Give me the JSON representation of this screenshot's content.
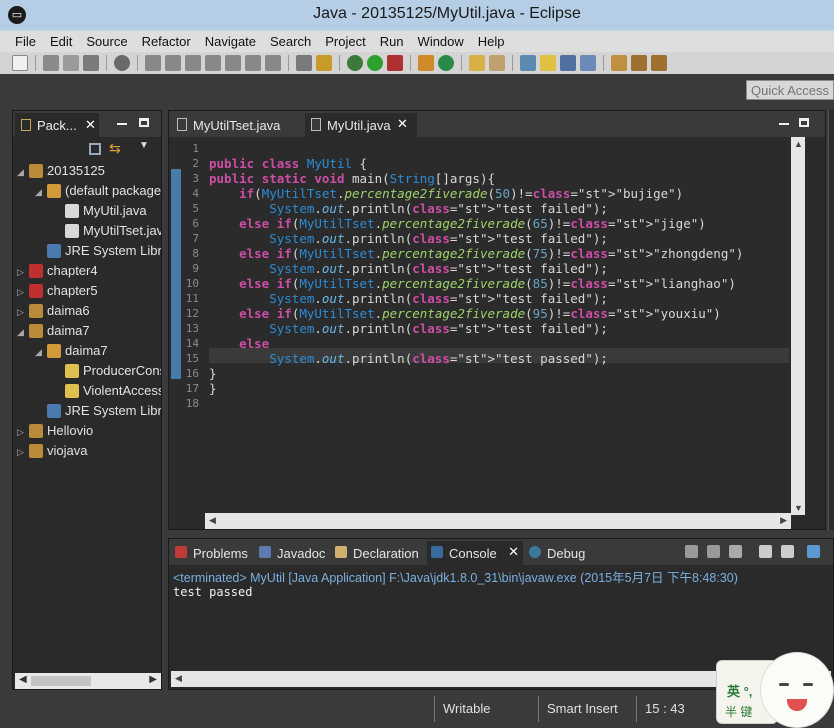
{
  "window": {
    "title": "Java - 20135125/MyUtil.java - Eclipse"
  },
  "menu": [
    "File",
    "Edit",
    "Source",
    "Refactor",
    "Navigate",
    "Search",
    "Project",
    "Run",
    "Window",
    "Help"
  ],
  "quick_access": {
    "placeholder": "Quick Access"
  },
  "package_explorer": {
    "tab_label": "Pack...",
    "tree": [
      {
        "label": "20135125",
        "depth": 0,
        "icon": "project-icon",
        "expanded": true
      },
      {
        "label": "(default package)",
        "depth": 1,
        "icon": "package-icon",
        "expanded": true
      },
      {
        "label": "MyUtil.java",
        "depth": 2,
        "icon": "java-file-icon"
      },
      {
        "label": "MyUtilTset.java",
        "depth": 2,
        "icon": "java-file-icon"
      },
      {
        "label": "JRE System Library",
        "depth": 1,
        "icon": "library-icon"
      },
      {
        "label": "chapter4",
        "depth": 0,
        "icon": "project-error-icon"
      },
      {
        "label": "chapter5",
        "depth": 0,
        "icon": "project-error-icon"
      },
      {
        "label": "daima6",
        "depth": 0,
        "icon": "project-icon"
      },
      {
        "label": "daima7",
        "depth": 0,
        "icon": "project-icon",
        "expanded": true
      },
      {
        "label": "daima7",
        "depth": 1,
        "icon": "package-icon",
        "expanded": true
      },
      {
        "label": "ProducerConsumer.java",
        "depth": 2,
        "icon": "java-warn-icon"
      },
      {
        "label": "ViolentAccess.java",
        "depth": 2,
        "icon": "java-warn-icon"
      },
      {
        "label": "JRE System Library",
        "depth": 1,
        "icon": "library-icon"
      },
      {
        "label": "Hellovio",
        "depth": 0,
        "icon": "project-icon"
      },
      {
        "label": "viojava",
        "depth": 0,
        "icon": "project-icon"
      }
    ]
  },
  "editor": {
    "tabs": [
      {
        "label": "MyUtilTset.java",
        "active": false
      },
      {
        "label": "MyUtil.java",
        "active": true
      }
    ],
    "line_numbers": [
      "1",
      "2",
      "3",
      "4",
      "5",
      "6",
      "7",
      "8",
      "9",
      "10",
      "11",
      "12",
      "13",
      "14",
      "15",
      "16",
      "17",
      "18"
    ],
    "lines": [
      "",
      "public class MyUtil {",
      "public static void main(String[]args){",
      "    if(MyUtilTset.percentage2fiverade(50)!=\"bujige\")",
      "        System.out.println(\"test failed\");",
      "    else if(MyUtilTset.percentage2fiverade(65)!=\"jige\")",
      "        System.out.println(\"test failed\");",
      "    else if(MyUtilTset.percentage2fiverade(75)!=\"zhongdeng\")",
      "        System.out.println(\"test failed\");",
      "    else if(MyUtilTset.percentage2fiverade(85)!=\"lianghao\")",
      "        System.out.println(\"test failed\");",
      "    else if(MyUtilTset.percentage2fiverade(95)!=\"youxiu\")",
      "        System.out.println(\"test failed\");",
      "    else",
      "        System.out.println(\"test passed\");",
      "}",
      "}",
      ""
    ]
  },
  "console": {
    "tabs": [
      "Problems",
      "Javadoc",
      "Declaration",
      "Console",
      "Debug"
    ],
    "active_tab": "Console",
    "info": "<terminated> MyUtil [Java Application] F:\\Java\\jdk1.8.0_31\\bin\\javaw.exe (2015年5月7日 下午8:48:30)",
    "output": "test passed"
  },
  "status": {
    "writable": "Writable",
    "insert_mode": "Smart Insert",
    "position": "15 : 43"
  },
  "mascot": {
    "text1": "英 °,",
    "text2": "半 键"
  },
  "colors": {
    "titlebar": "#b5cde5",
    "keyword": "#cc4da6",
    "class": "#2d8cd6",
    "string": "#9cccfa",
    "method_italic": "#9ed36a",
    "console_info": "#7ab0e0"
  }
}
